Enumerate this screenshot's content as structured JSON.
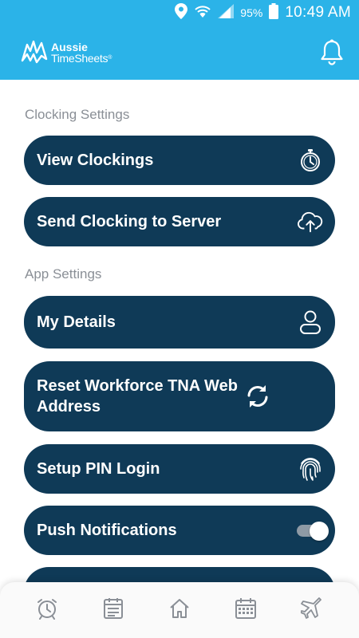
{
  "status_bar": {
    "battery": "95%",
    "time": "10:49 AM",
    "icons": [
      "location-icon",
      "wifi-icon",
      "signal-icon",
      "battery-icon"
    ]
  },
  "app_bar": {
    "logo_line1": "Aussie",
    "logo_line2": "TimeSheets",
    "logo_trademark": "®",
    "notification_icon": "bell-icon"
  },
  "sections": {
    "clocking": {
      "title": "Clocking Settings",
      "items": [
        {
          "label": "View Clockings",
          "icon": "stopwatch-icon"
        },
        {
          "label": "Send Clocking to Server",
          "icon": "cloud-upload-icon"
        }
      ]
    },
    "app": {
      "title": "App Settings",
      "items": [
        {
          "label": "My Details",
          "icon": "user-icon"
        },
        {
          "label": "Reset Workforce TNA Web Address",
          "icon": "sync-icon"
        },
        {
          "label": "Setup PIN Login",
          "icon": "fingerprint-icon"
        },
        {
          "label": "Push Notifications",
          "icon": "toggle-switch",
          "toggle_on_fraction": 1
        }
      ]
    }
  },
  "bottom_nav": [
    "alarm-clock-icon",
    "timesheet-icon",
    "home-icon",
    "calendar-icon",
    "airplane-icon"
  ],
  "colors": {
    "primary": "#2bb3e8",
    "pill": "#0f3a57",
    "section_text": "#8a8f96",
    "nav_icon": "#8a8f96"
  }
}
